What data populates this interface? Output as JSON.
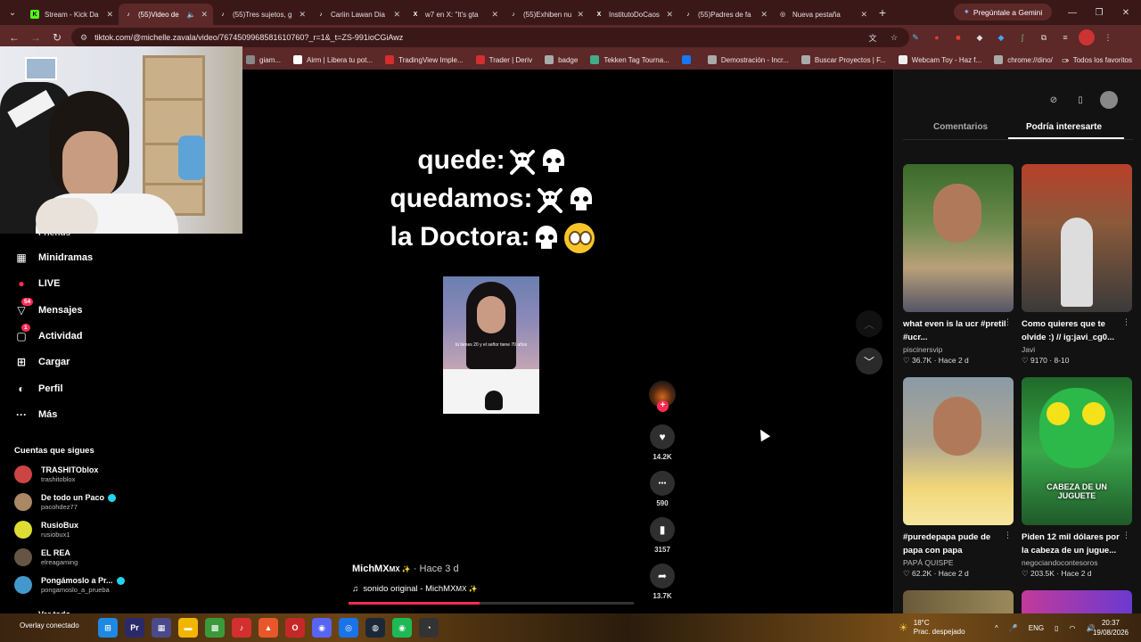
{
  "browser": {
    "tabs": [
      {
        "title": "Stream - Kick Da",
        "favicon": "kick",
        "color": "#53fc18",
        "active": false
      },
      {
        "title": "(55)Video de",
        "favicon": "tiktok",
        "color": "#ffffff",
        "active": true,
        "audio": true
      },
      {
        "title": "(55)Tres sujetos, g",
        "favicon": "tiktok",
        "color": "#ffffff",
        "active": false
      },
      {
        "title": "Cariin Lawan Dia",
        "favicon": "tiktok",
        "color": "#ffffff",
        "active": false
      },
      {
        "title": "w7 en X: \"It's gta",
        "favicon": "x",
        "color": "#ffffff",
        "active": false
      },
      {
        "title": "(55)Exhiben nue",
        "favicon": "tiktok",
        "color": "#ffffff",
        "active": false
      },
      {
        "title": "InstitutoDoCaos",
        "favicon": "x",
        "color": "#ffffff",
        "active": false
      },
      {
        "title": "(55)Padres de fa",
        "favicon": "tiktok",
        "color": "#ffffff",
        "active": false
      },
      {
        "title": "Nueva pestaña",
        "favicon": "chrome",
        "color": "#ffffff",
        "active": false
      }
    ],
    "new_tab": "+",
    "gemini_label": "Pregúntale a Gemini",
    "url": "tiktok.com/@michelle.zavala/video/7674509968581610760?_r=1&_t=ZS-991ioCGiAwz",
    "bookmarks": [
      {
        "label": "giam...",
        "icon_color": "#888"
      },
      {
        "label": "Airm | Libera tu pot...",
        "icon_color": "#fff"
      },
      {
        "label": "TradingView Imple...",
        "icon_color": "#d32f2f"
      },
      {
        "label": "Trader | Deriv",
        "icon_color": "#d32f2f"
      },
      {
        "label": "badge",
        "icon_color": "#aaa"
      },
      {
        "label": "Tekken Tag Tourna...",
        "icon_color": "#4a8"
      },
      {
        "label": "",
        "icon_color": "#1877f2"
      },
      {
        "label": "Demostración - Incr...",
        "icon_color": "#aaa"
      },
      {
        "label": "Buscar Proyectos | F...",
        "icon_color": "#aaa"
      },
      {
        "label": "Webcam Toy - Haz f...",
        "icon_color": "#eee"
      },
      {
        "label": "chrome://dino/",
        "icon_color": "#aaa"
      }
    ],
    "all_favorites": "Todos los favoritos"
  },
  "sidebar": {
    "items": [
      {
        "label": "Minidramas",
        "icon": "minidramas-icon",
        "badge": ""
      },
      {
        "label": "LIVE",
        "icon": "live-icon",
        "badge": ""
      },
      {
        "label": "Mensajes",
        "icon": "messages-icon",
        "badge": "54"
      },
      {
        "label": "Actividad",
        "icon": "activity-icon",
        "badge": "1"
      },
      {
        "label": "Cargar",
        "icon": "upload-icon",
        "badge": ""
      },
      {
        "label": "Perfil",
        "icon": "profile-icon",
        "badge": ""
      },
      {
        "label": "Más",
        "icon": "more-icon",
        "badge": ""
      }
    ],
    "partial_item": "Friends",
    "following_title": "Cuentas que sigues",
    "following": [
      {
        "name": "TRASHITOblox",
        "user": "trashitoblox",
        "verified": false,
        "color": "#c44"
      },
      {
        "name": "De todo un Paco",
        "user": "pacohdez77",
        "verified": true,
        "color": "#a86"
      },
      {
        "name": "RusioBux",
        "user": "rusiobux1",
        "verified": false,
        "color": "#dd3"
      },
      {
        "name": "EL REA",
        "user": "elreagaming",
        "verified": false,
        "color": "#654"
      },
      {
        "name": "Pongámoslo a Pr...",
        "user": "pongamoslo_a_prueba",
        "verified": true,
        "color": "#49c"
      }
    ],
    "see_all": "Ver todo"
  },
  "video": {
    "caption_lines": [
      "quede:",
      "quedamos:",
      "la Doctora:"
    ],
    "inner_subtitle": "tú tienes 20 y el señor tiene 70 años",
    "author": "MichMX",
    "author_suffix": "MX ✨",
    "time": "· Hace 3 d",
    "sound": "sonido original - MichMX",
    "sound_suffix": "MX ✨",
    "progress": 0.46,
    "actions": [
      {
        "name": "like",
        "icon": "heart-icon",
        "count": "14.2K"
      },
      {
        "name": "comment",
        "icon": "comment-icon",
        "count": "590"
      },
      {
        "name": "save",
        "icon": "bookmark-icon",
        "count": "3157"
      },
      {
        "name": "share",
        "icon": "share-icon",
        "count": "13.7K"
      }
    ]
  },
  "right_panel": {
    "tab_comments": "Comentarios",
    "tab_suggested": "Podría interesarte",
    "cards": [
      {
        "title": "what even is la ucr #pretil #ucr...",
        "author": "piscinersvip",
        "likes": "36.7K",
        "time": "Hace 2 d"
      },
      {
        "title": "Como quieres que te olvide :) // ig:javi_cg0...",
        "author": "Javi",
        "likes": "9170",
        "time": "8-10"
      },
      {
        "title": "#puredepapa pude de papa con papa",
        "author": "PAPÁ QUISPE",
        "likes": "62.2K",
        "time": "Hace 2 d"
      },
      {
        "title": "Piden 12 mil dólares por la cabeza de un jugue...",
        "author": "negociandocontesoros",
        "likes": "203.5K",
        "time": "Hace 2 d"
      }
    ],
    "thumb_overlay": "CABEZA DE UN JUGUETE"
  },
  "taskbar": {
    "overlay_text": "Overlay conectado",
    "temperature": "18°C",
    "weather": "Prac. despejado",
    "language": "ENG",
    "time": "20:37",
    "date": "19/08/2026"
  }
}
